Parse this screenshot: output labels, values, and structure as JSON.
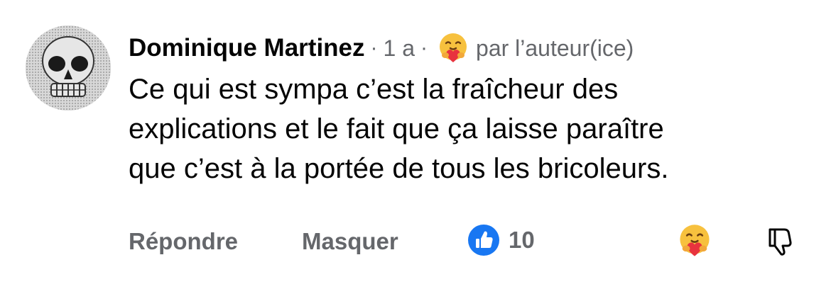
{
  "comment": {
    "author": "Dominique Martinez",
    "separator": "·",
    "age": "1 a",
    "badge_text": "par l’auteur(ice)",
    "text": "Ce qui est sympa c’est la fraîcheur des\nexplications et le fait que ça laisse paraître\nque c’est à la portée de tous les bricoleurs."
  },
  "actions": {
    "reply_label": "Répondre",
    "hide_label": "Masquer",
    "reaction_count": "10"
  },
  "icons": {
    "avatar": "skull-avatar",
    "author_reaction": "care-emoji-icon",
    "like": "like-thumb-icon",
    "care": "care-emoji-icon",
    "dislike": "thumbs-down-icon"
  },
  "colors": {
    "text": "#050505",
    "secondary": "#65676b",
    "like_blue": "#1877f2",
    "emoji_yellow": "#f7c13e",
    "emoji_heart": "#e8333e"
  }
}
